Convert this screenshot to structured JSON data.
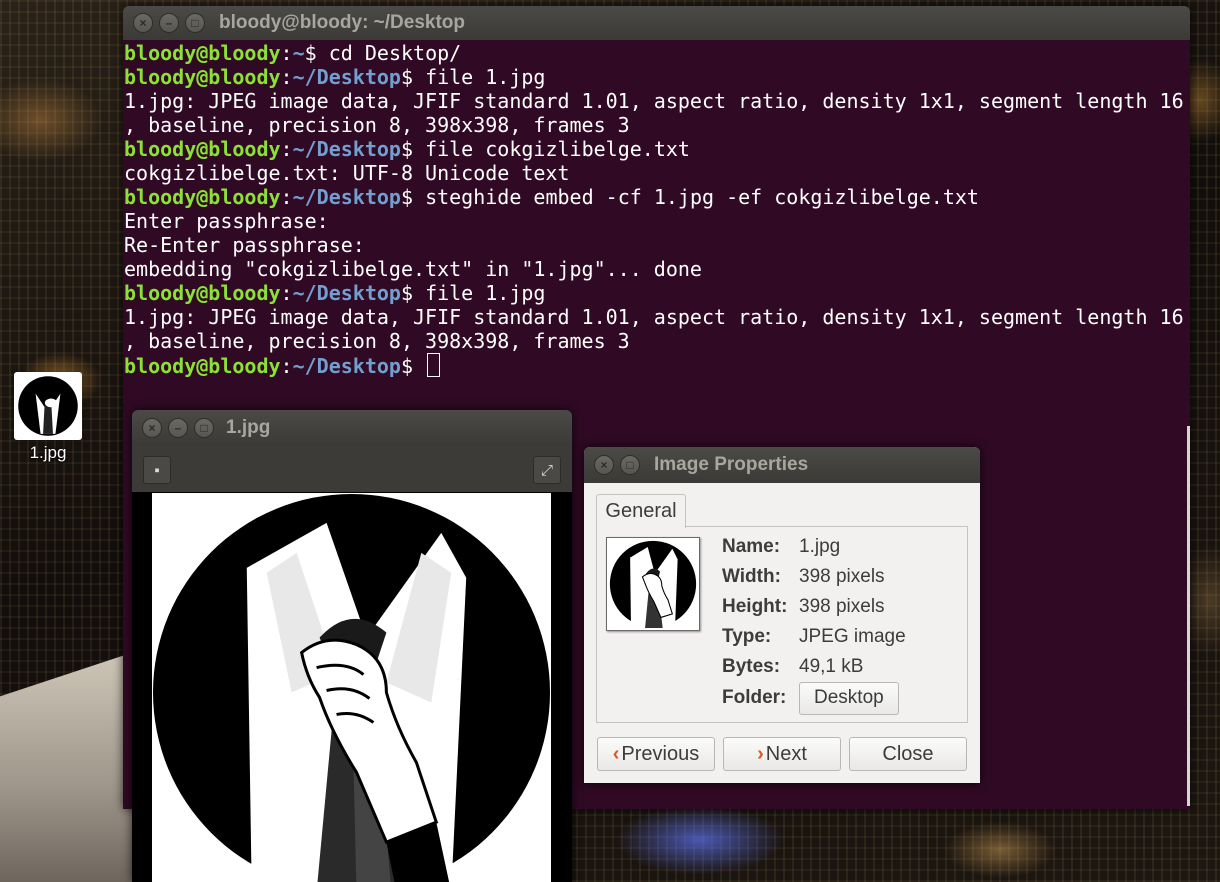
{
  "terminal": {
    "title": "bloody@bloody: ~/Desktop",
    "lines": [
      {
        "user": "bloody@bloody",
        "sep": ":",
        "path": "~",
        "prompt": "$ ",
        "text": "cd Desktop/"
      },
      {
        "user": "bloody@bloody",
        "sep": ":",
        "path": "~/Desktop",
        "prompt": "$ ",
        "text": "file 1.jpg"
      },
      {
        "text": "1.jpg: JPEG image data, JFIF standard 1.01, aspect ratio, density 1x1, segment length 16"
      },
      {
        "text": ", baseline, precision 8, 398x398, frames 3"
      },
      {
        "user": "bloody@bloody",
        "sep": ":",
        "path": "~/Desktop",
        "prompt": "$ ",
        "text": "file cokgizlibelge.txt"
      },
      {
        "text": "cokgizlibelge.txt: UTF-8 Unicode text"
      },
      {
        "user": "bloody@bloody",
        "sep": ":",
        "path": "~/Desktop",
        "prompt": "$ ",
        "text": "steghide embed -cf 1.jpg -ef cokgizlibelge.txt"
      },
      {
        "text": "Enter passphrase:"
      },
      {
        "text": "Re-Enter passphrase:"
      },
      {
        "text": "embedding \"cokgizlibelge.txt\" in \"1.jpg\"... done"
      },
      {
        "user": "bloody@bloody",
        "sep": ":",
        "path": "~/Desktop",
        "prompt": "$ ",
        "text": "file 1.jpg"
      },
      {
        "text": "1.jpg: JPEG image data, JFIF standard 1.01, aspect ratio, density 1x1, segment length 16"
      },
      {
        "text": ", baseline, precision 8, 398x398, frames 3"
      },
      {
        "user": "bloody@bloody",
        "sep": ":",
        "path": "~/Desktop",
        "prompt": "$ ",
        "text": "",
        "cursor": true
      }
    ]
  },
  "desktop_icon": {
    "label": "1.jpg",
    "icon": "anonymous-suit-image-icon"
  },
  "viewer": {
    "title": "1.jpg"
  },
  "properties": {
    "title": "Image Properties",
    "tab": "General",
    "fields": [
      {
        "key": "Name:",
        "value": "1.jpg"
      },
      {
        "key": "Width:",
        "value": "398 pixels"
      },
      {
        "key": "Height:",
        "value": "398 pixels"
      },
      {
        "key": "Type:",
        "value": "JPEG image"
      },
      {
        "key": "Bytes:",
        "value": "49,1 kB"
      }
    ],
    "folder_key": "Folder:",
    "folder_value": "Desktop",
    "buttons": {
      "previous": "Previous",
      "next": "Next",
      "close": "Close"
    }
  },
  "colors": {
    "terminal_bg": "#300a24",
    "prompt_user": "#8ae234",
    "prompt_path": "#729fcf",
    "accent_chevron": "#e2541d"
  }
}
